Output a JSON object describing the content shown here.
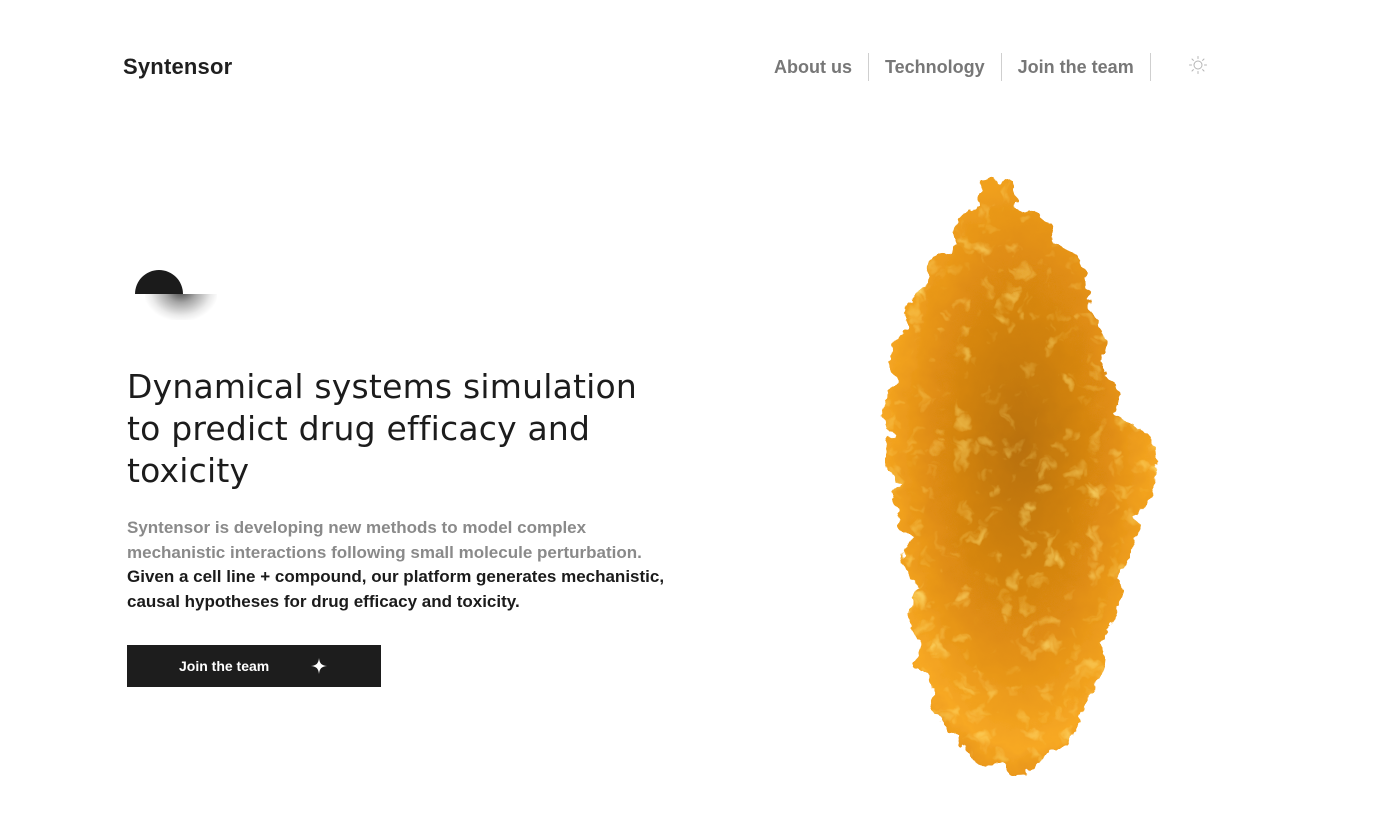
{
  "header": {
    "logo": "Syntensor",
    "nav": [
      {
        "label": "About us"
      },
      {
        "label": "Technology"
      },
      {
        "label": "Join the team"
      }
    ],
    "theme_toggle_icon": "sun-icon"
  },
  "hero": {
    "headline": "Dynamical systems simulation to predict drug efficacy and toxicity",
    "description_muted": "Syntensor is developing new methods to model complex mechanistic interactions following small molecule perturbation.",
    "description_strong": "Given a cell line + compound, our platform generates mechanistic, causal hypotheses for drug efficacy and toxicity.",
    "cta_label": "Join the team",
    "cta_icon": "plus-icon",
    "illustration_icon": "protein-structure-illustration"
  },
  "colors": {
    "accent_orange": "#f5a21a",
    "dark": "#1d1d1d",
    "muted_text": "#8a8a8a",
    "nav_text": "#777777"
  }
}
